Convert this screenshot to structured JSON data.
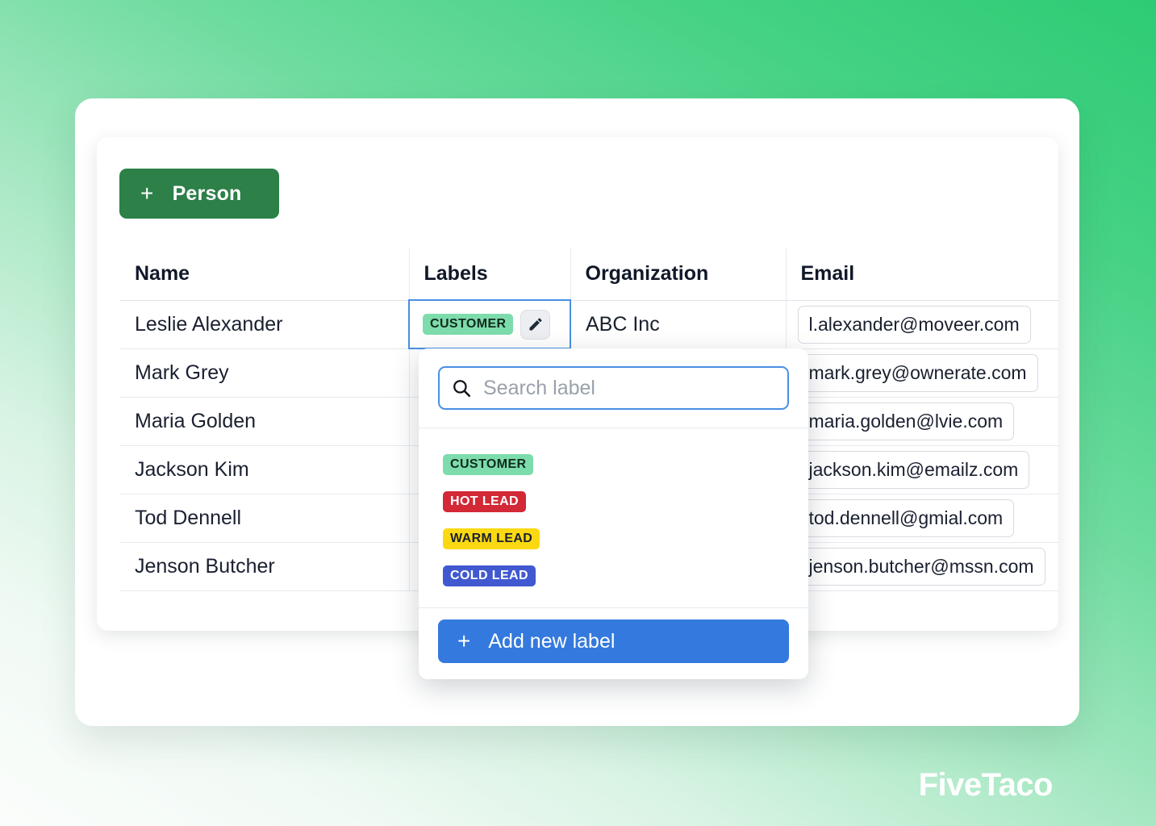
{
  "brand": {
    "name": "FiveTaco"
  },
  "toolbar": {
    "add_person_label": "Person",
    "add_person_icon": "plus-icon"
  },
  "table": {
    "columns": [
      "Name",
      "Labels",
      "Organization",
      "Email"
    ],
    "rows": [
      {
        "name": "Leslie Alexander",
        "label": "CUSTOMER",
        "label_color": "#7ddcab",
        "label_text_color": "#102a1c",
        "organization": "ABC Inc",
        "email": "l.alexander@moveer.com",
        "edit_icon": "pencil-icon"
      },
      {
        "name": "Mark Grey",
        "label": "",
        "organization": "",
        "email": "mark.grey@ownerate.com"
      },
      {
        "name": "Maria Golden",
        "label": "",
        "organization": "",
        "email": "maria.golden@lvie.com"
      },
      {
        "name": "Jackson Kim",
        "label": "",
        "organization": "",
        "email": "jackson.kim@emailz.com"
      },
      {
        "name": "Tod Dennell",
        "label": "",
        "organization": "",
        "email": "tod.dennell@gmial.com"
      },
      {
        "name": "Jenson Butcher",
        "label": "",
        "organization": "",
        "email": "jenson.butcher@mssn.com"
      }
    ]
  },
  "dropdown": {
    "search": {
      "value": "",
      "placeholder": "Search label",
      "icon": "search-icon"
    },
    "options": [
      {
        "name": "CUSTOMER",
        "bg": "#7ddcab",
        "fg": "#102a1c"
      },
      {
        "name": "HOT LEAD",
        "bg": "#d32836",
        "fg": "#ffffff"
      },
      {
        "name": "WARM LEAD",
        "bg": "#fad913",
        "fg": "#1a2030"
      },
      {
        "name": "COLD LEAD",
        "bg": "#4159d0",
        "fg": "#ffffff"
      }
    ],
    "add_new": {
      "label": "Add new label",
      "icon": "plus-icon",
      "color": "#3479dd"
    }
  },
  "colors": {
    "brand_green": "#2c8048",
    "accent_blue": "#3479dd",
    "focus_blue": "#4a90e2",
    "background_gradient_from": "#2ecb74",
    "background_gradient_to": "#fbfdfb"
  }
}
